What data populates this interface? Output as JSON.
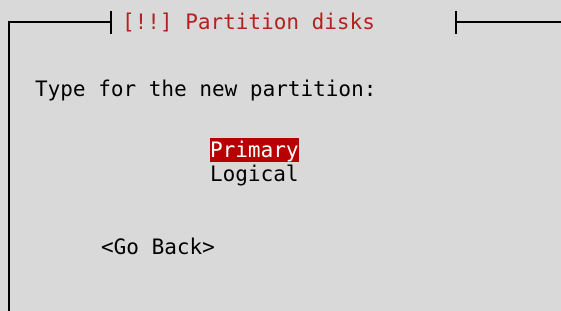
{
  "dialog": {
    "title": "[!!] Partition disks",
    "prompt": "Type for the new partition:",
    "options": [
      {
        "label": "Primary",
        "selected": true
      },
      {
        "label": "Logical",
        "selected": false
      }
    ],
    "go_back_label": "<Go Back>"
  },
  "colors": {
    "background": "#d9d9d9",
    "title_text": "#b52020",
    "selected_background": "#b80000",
    "selected_text": "#ffffff",
    "text": "#000000"
  }
}
